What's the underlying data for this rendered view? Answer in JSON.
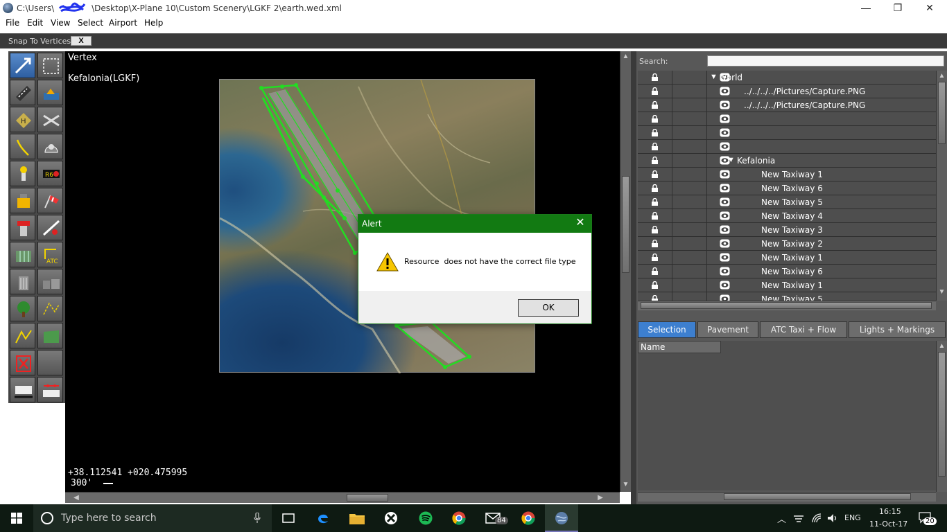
{
  "window": {
    "title_path_prefix": "C:\\Users\\",
    "title_path_suffix": "\\Desktop\\X-Plane 10\\Custom Scenery\\LGKF 2\\earth.wed.xml",
    "minimize": "—",
    "restore": "❐",
    "close": "✕"
  },
  "menu": [
    "File",
    "Edit",
    "View",
    "Select",
    "Airport",
    "Help"
  ],
  "snapbar": {
    "label": "Snap To Vertices",
    "checkbox": "X"
  },
  "map": {
    "tool_name": "Vertex",
    "airport_name": "Kefalonia(LGKF)",
    "coordinates": "+38.112541 +020.475995",
    "scale": "300'"
  },
  "tools": [
    "vertex-select",
    "marquee-select",
    "runway",
    "sealane",
    "helipad",
    "ramp-start",
    "taxiway",
    "boundary",
    "light-fixture",
    "taxi-sign",
    "tower-viewpoint",
    "windsock",
    "beacon",
    "exclusion-zone",
    "facade",
    "atc-flow",
    "object",
    "object-string",
    "forest",
    "line",
    "polygon-draw",
    "polygon",
    "exclusion",
    "blank",
    "marker-sign",
    "stopway"
  ],
  "search": {
    "label": "Search:",
    "value": ""
  },
  "tree": [
    {
      "name": "world",
      "indent": 0,
      "expanded": true
    },
    {
      "name": "../../../../Pictures/Capture.PNG",
      "indent": 1
    },
    {
      "name": "../../../../Pictures/Capture.PNG",
      "indent": 1
    },
    {
      "name": "",
      "indent": 1
    },
    {
      "name": "",
      "indent": 1
    },
    {
      "name": "",
      "indent": 1
    },
    {
      "name": "Kefalonia",
      "indent": 1,
      "expanded": true
    },
    {
      "name": "New Taxiway 1",
      "indent": 2
    },
    {
      "name": "New Taxiway 6",
      "indent": 2
    },
    {
      "name": "New Taxiway 5",
      "indent": 2
    },
    {
      "name": "New Taxiway 4",
      "indent": 2
    },
    {
      "name": "New Taxiway 3",
      "indent": 2
    },
    {
      "name": "New Taxiway 2",
      "indent": 2
    },
    {
      "name": "New Taxiway 1",
      "indent": 2
    },
    {
      "name": "New Taxiway 6",
      "indent": 2
    },
    {
      "name": "New Taxiway 1",
      "indent": 2
    },
    {
      "name": "New Taxiway 5",
      "indent": 2
    }
  ],
  "tabs": [
    {
      "label": "Selection",
      "active": true
    },
    {
      "label": "Pavement"
    },
    {
      "label": "ATC Taxi + Flow"
    },
    {
      "label": "Lights + Markings"
    }
  ],
  "props": {
    "header": "Name"
  },
  "dialog": {
    "title": "Alert",
    "message": "Resource  does not have the correct file type",
    "ok": "OK",
    "close": "✕"
  },
  "taskbar": {
    "search_placeholder": "Type here to search",
    "mail_badge": "84",
    "language": "ENG",
    "time": "16:15",
    "date": "11-Oct-17",
    "notifications": "20"
  },
  "colors": {
    "dialog_title": "#127a12",
    "active_tab": "#3d7fcf",
    "taxiway": "#22dd22"
  }
}
